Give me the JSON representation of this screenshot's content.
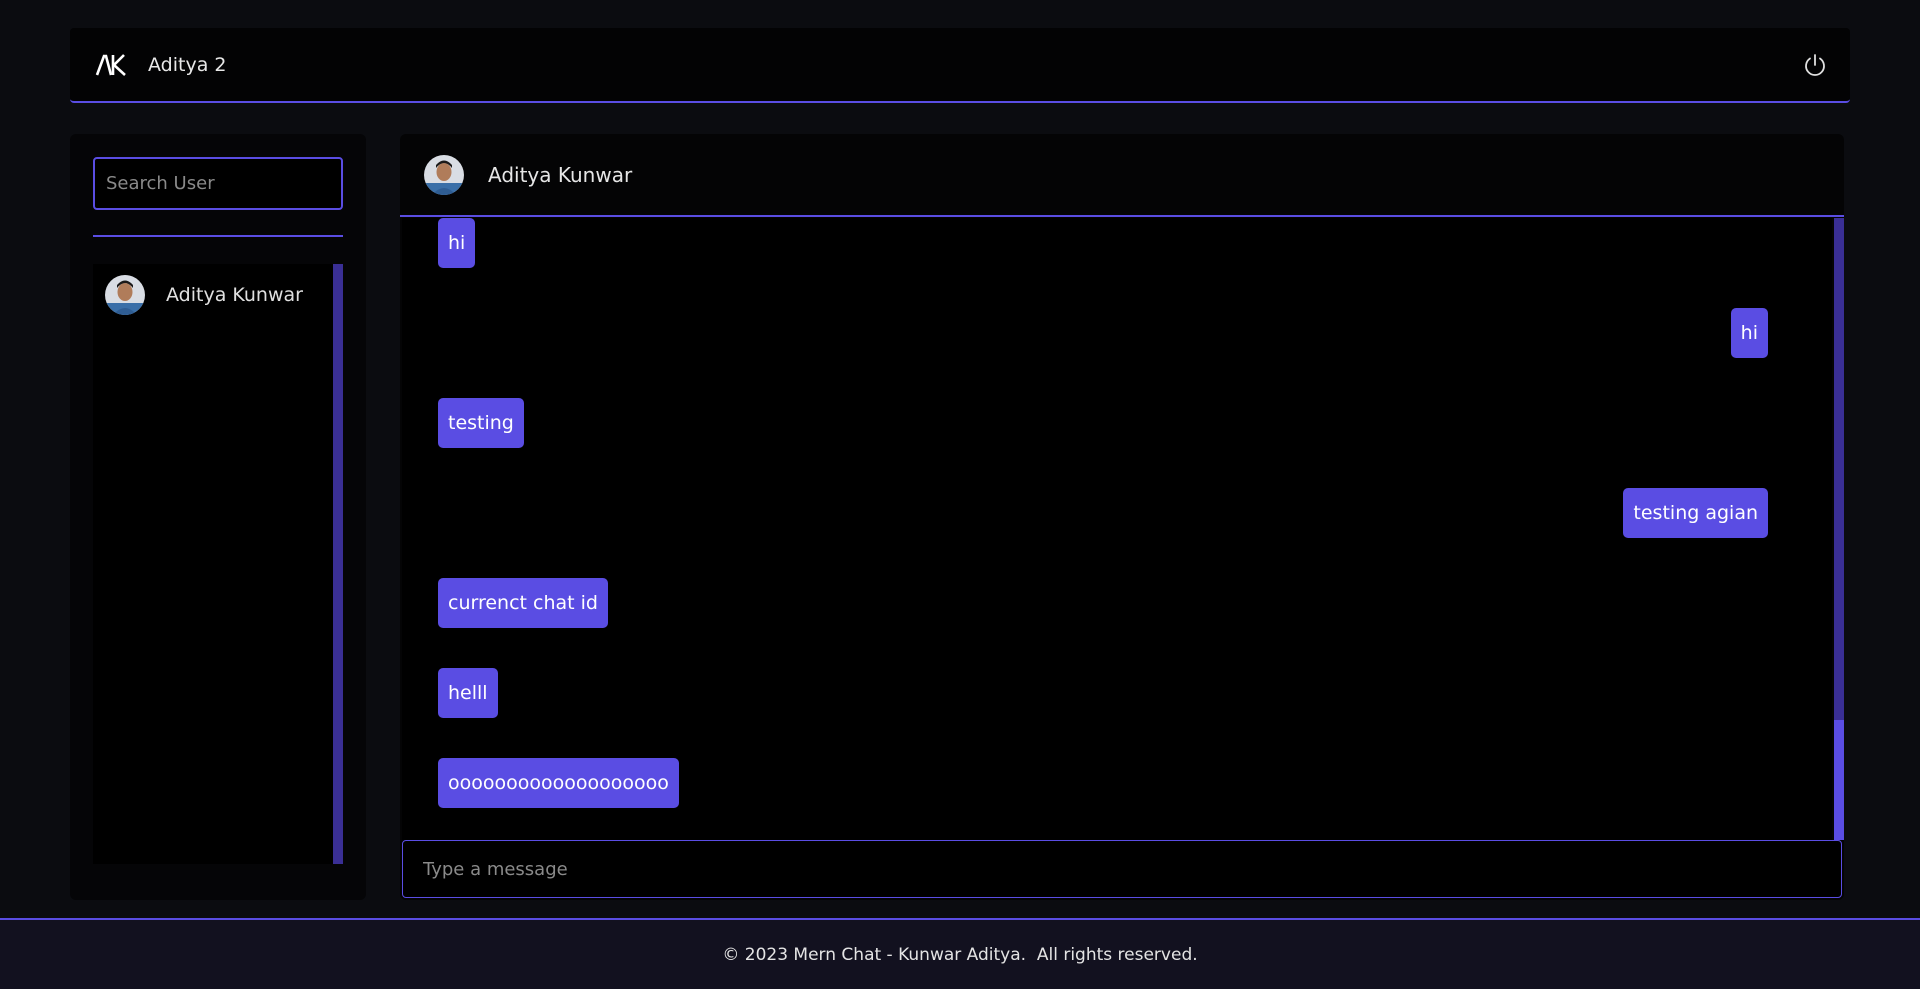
{
  "theme": {
    "accent": "#5a4de3",
    "background": "#0b0c10",
    "panel": "#040405"
  },
  "navbar": {
    "logo_icon": "ak-logo-icon",
    "current_user": "Aditya 2",
    "logout_icon": "power-icon"
  },
  "sidebar": {
    "search_placeholder": "Search User",
    "search_value": "",
    "users": [
      {
        "name": "Aditya Kunwar",
        "avatar_icon": "avatar-icon"
      }
    ]
  },
  "chat": {
    "header": {
      "name": "Aditya Kunwar",
      "avatar_icon": "avatar-icon"
    },
    "messages": [
      {
        "text": "hi",
        "direction": "incoming"
      },
      {
        "text": "hi",
        "direction": "outgoing"
      },
      {
        "text": "testing",
        "direction": "incoming"
      },
      {
        "text": "testing agian",
        "direction": "outgoing"
      },
      {
        "text": "currenct chat id",
        "direction": "incoming"
      },
      {
        "text": "helll",
        "direction": "incoming"
      },
      {
        "text": "ooooooooooooooooooo",
        "direction": "incoming"
      }
    ],
    "composer_placeholder": "Type a message",
    "composer_value": ""
  },
  "footer": {
    "text": "© 2023 Mern Chat - Kunwar Aditya.  All rights reserved."
  }
}
